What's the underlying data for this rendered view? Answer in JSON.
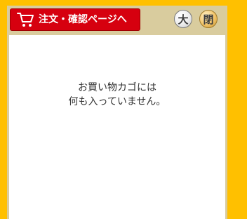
{
  "header": {
    "order_button_label": "注文・確認ページへ",
    "large_button_label": "大",
    "close_button_label": "閉"
  },
  "cart": {
    "empty_message_line1": "お買い物カゴには",
    "empty_message_line2": "何も入っていません。"
  },
  "icons": {
    "cart": "cart-icon"
  },
  "colors": {
    "page_background": "#ffc000",
    "panel_frame": "#d9cc9e",
    "order_button": "#d6000f",
    "close_button": "#f2c46a"
  }
}
